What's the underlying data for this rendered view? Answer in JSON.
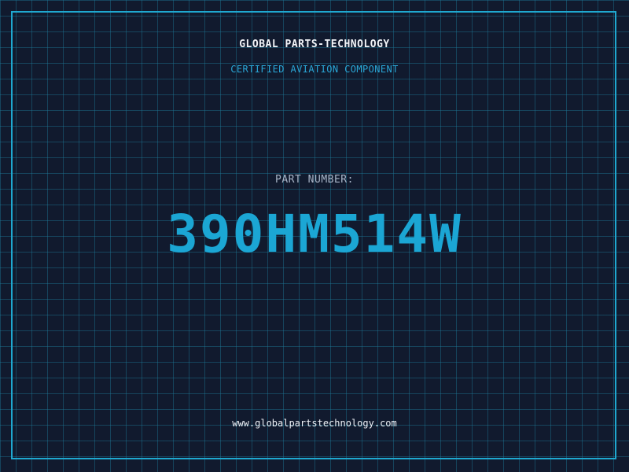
{
  "header": {
    "company": "GLOBAL PARTS-TECHNOLOGY",
    "tagline": "CERTIFIED AVIATION COMPONENT"
  },
  "part": {
    "label": "PART NUMBER:",
    "number": "390HM514W"
  },
  "footer": {
    "website": "www.globalpartstechnology.com"
  },
  "colors": {
    "background": "#111a2e",
    "grid": "#1e7896",
    "accent": "#1ba6d4",
    "frame": "#1fa8d0"
  }
}
